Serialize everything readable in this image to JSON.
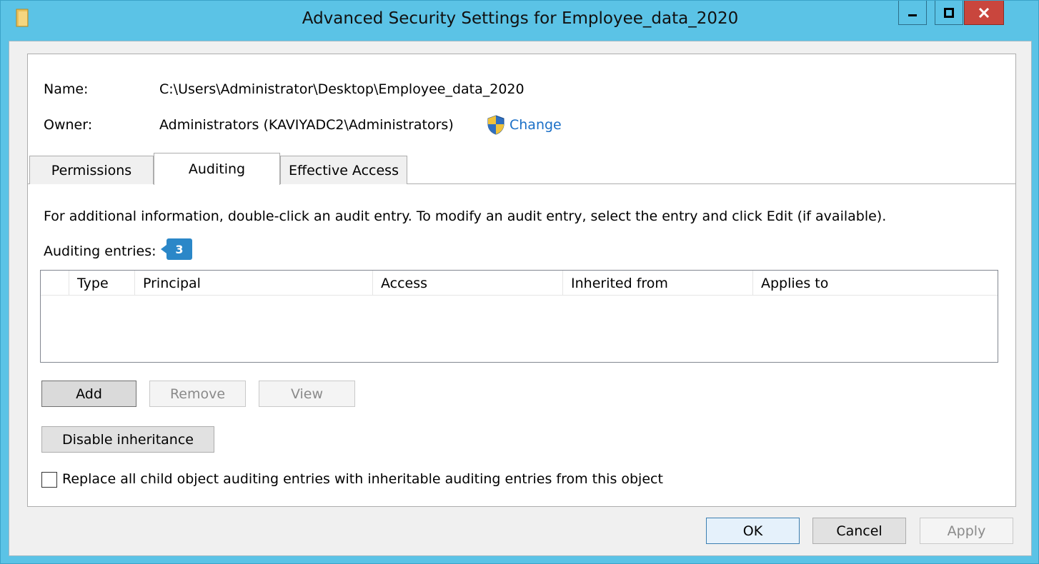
{
  "window": {
    "title": "Advanced Security Settings for Employee_data_2020"
  },
  "info": {
    "name_label": "Name:",
    "name_value": "C:\\Users\\Administrator\\Desktop\\Employee_data_2020",
    "owner_label": "Owner:",
    "owner_value": "Administrators (KAVIYADC2\\Administrators)",
    "change_link": "Change"
  },
  "tabs": [
    {
      "label": "Permissions",
      "active": false
    },
    {
      "label": "Auditing",
      "active": true
    },
    {
      "label": "Effective Access",
      "active": false
    }
  ],
  "auditing": {
    "info_text": "For additional information, double-click an audit entry. To modify an audit entry, select the entry and click Edit (if available).",
    "entries_label": "Auditing entries:",
    "badge": "3",
    "columns": [
      "Type",
      "Principal",
      "Access",
      "Inherited from",
      "Applies to"
    ],
    "rows": []
  },
  "buttons": {
    "add": "Add",
    "remove": "Remove",
    "view": "View",
    "disable_inheritance": "Disable inheritance"
  },
  "replace_checkbox": {
    "label": "Replace all child object auditing entries with inheritable auditing entries from this object",
    "checked": false
  },
  "footer": {
    "ok": "OK",
    "cancel": "Cancel",
    "apply": "Apply"
  },
  "colors": {
    "titlebar": "#5bc3e6",
    "close": "#c9463d",
    "link": "#1a6fc7",
    "badge": "#2b87c8"
  },
  "icons": [
    "folder-icon",
    "minimize-icon",
    "maximize-icon",
    "close-icon",
    "uac-shield-icon"
  ]
}
